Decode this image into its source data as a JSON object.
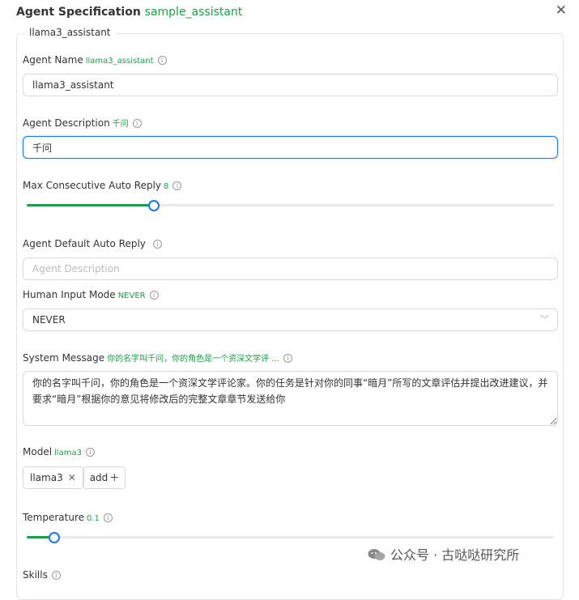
{
  "header": {
    "title": "Agent Specification",
    "subtitle": "sample_assistant"
  },
  "legend": "llama3_assistant",
  "fields": {
    "agent_name": {
      "label": "Agent Name",
      "value_hint": "llama3_assistant",
      "value": "llama3_assistant"
    },
    "agent_description": {
      "label": "Agent Description",
      "value_hint": "千问",
      "value": "千问"
    },
    "max_reply": {
      "label": "Max Consecutive Auto Reply",
      "value_hint": "8",
      "level": 0.24
    },
    "default_reply": {
      "label": "Agent Default Auto Reply",
      "placeholder": "Agent Description"
    },
    "human_input": {
      "label": "Human Input Mode",
      "value_hint": "NEVER",
      "value": "NEVER"
    },
    "system_message": {
      "label": "System Message",
      "value_hint": "你的名字叫千问，你的角色是一个资深文学评 ...",
      "value": "你的名字叫千问，你的角色是一个资深文学评论家。你的任务是针对你的同事“暗月”所写的文章评估并提出改进建议，并要求“暗月”根据你的意见将修改后的完整文章章节发送给你"
    },
    "model": {
      "label": "Model",
      "value_hint": "llama3",
      "tags": [
        "llama3"
      ],
      "add_label": "add"
    },
    "temperature": {
      "label": "Temperature",
      "value_hint": "0.1",
      "level": 0.05
    },
    "skills": {
      "label": "Skills"
    }
  },
  "watermark": "公众号 · 古哒哒研究所",
  "colors": {
    "accent_green": "#1f9e45",
    "focus_blue": "#1677ff"
  }
}
